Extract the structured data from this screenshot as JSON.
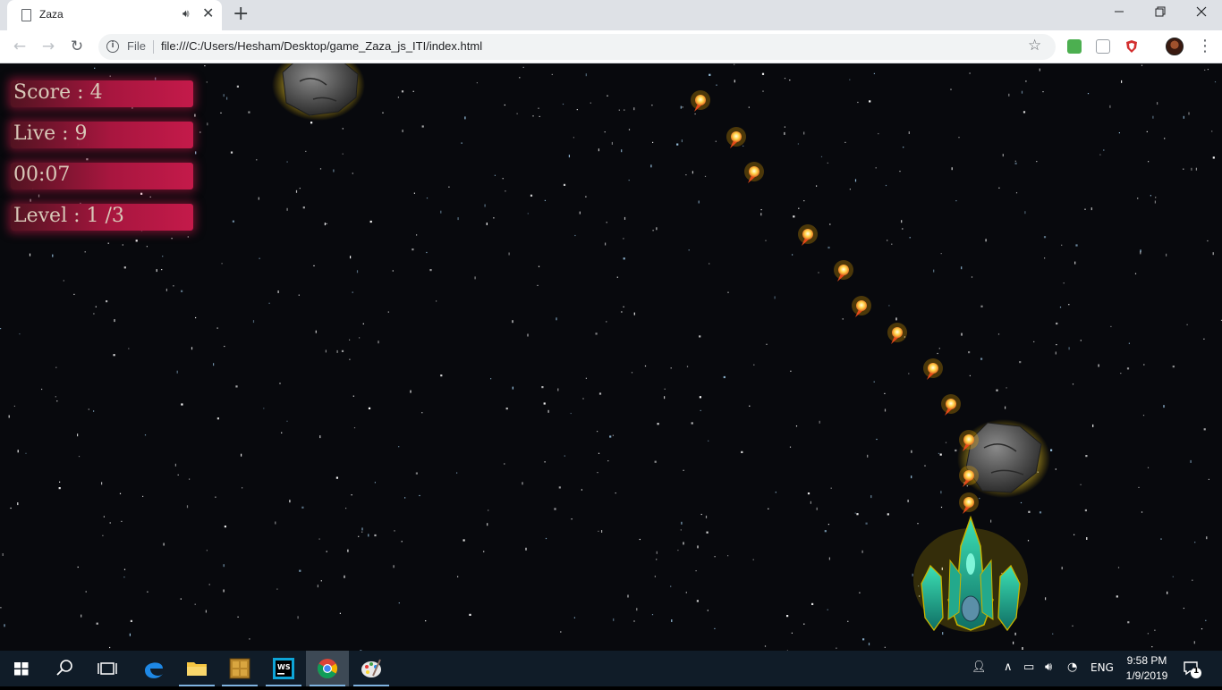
{
  "browser": {
    "tab_title": "Zaza",
    "scheme_label": "File",
    "url": "file:///C:/Users/Hesham/Desktop/game_Zaza_js_ITI/index.html",
    "new_tab_glyph": "+",
    "close_glyph": "✕"
  },
  "hud": {
    "score": "Score : 4",
    "lives": "Live : 9",
    "timer": "00:07",
    "level": "Level : 1 /3"
  },
  "taskbar": {
    "language": "ENG",
    "time": "9:58 PM",
    "date": "1/9/2019",
    "notification_count": "1"
  },
  "colors": {
    "hud_bar": "#c41a4a",
    "space": "#08090d",
    "taskbar": "#101c28"
  }
}
